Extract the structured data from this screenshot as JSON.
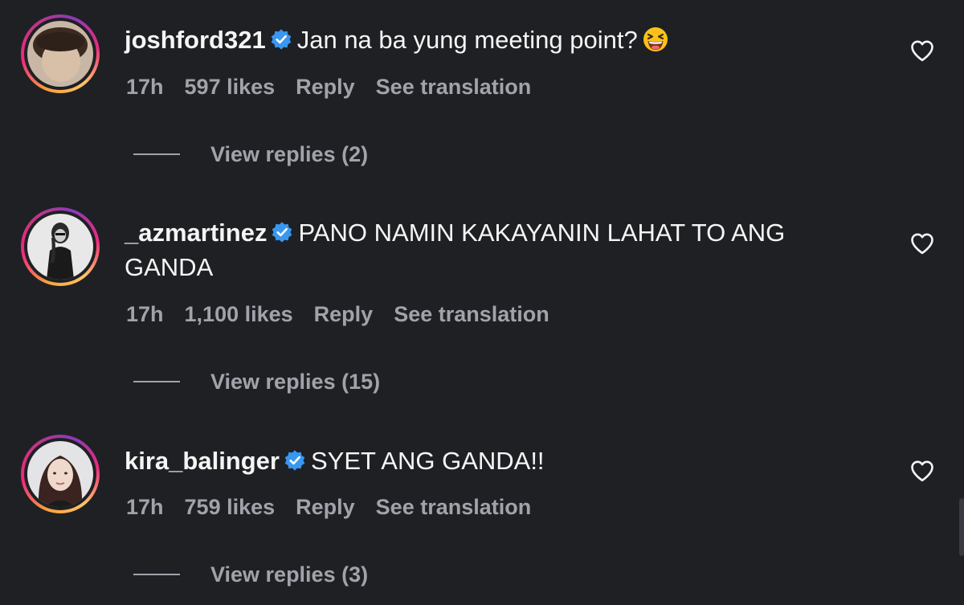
{
  "comments": [
    {
      "username": "joshford321",
      "text": "Jan na ba yung meeting point?",
      "time": "17h",
      "likes": "597 likes",
      "reply_label": "Reply",
      "translate_label": "See translation",
      "view_replies": "View replies (2)",
      "emoji": "grinning-squinting-face"
    },
    {
      "username": "_azmartinez",
      "text": "PANO NAMIN KAKAYANIN LAHAT TO ANG GANDA",
      "time": "17h",
      "likes": "1,100 likes",
      "reply_label": "Reply",
      "translate_label": "See translation",
      "view_replies": "View replies (15)"
    },
    {
      "username": "kira_balinger",
      "text": "SYET ANG GANDA!!",
      "time": "17h",
      "likes": "759 likes",
      "reply_label": "Reply",
      "translate_label": "See translation",
      "view_replies": "View replies (3)"
    }
  ],
  "colors": {
    "background": "#1f2024",
    "text": "#f5f5f5",
    "muted": "#a0a3aa",
    "verified": "#3897f0",
    "story_ring_start": "#f9a23a",
    "story_ring_end": "#c13584"
  }
}
